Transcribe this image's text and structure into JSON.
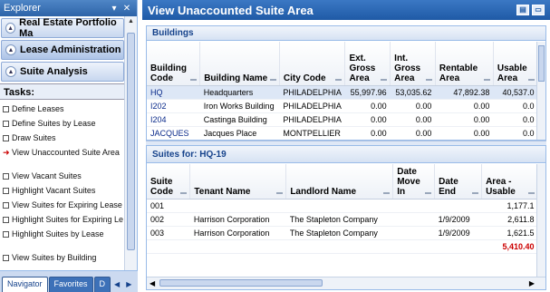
{
  "explorer": {
    "title": "Explorer",
    "pin_icon": "pin-icon",
    "close_icon": "close-icon",
    "sections": [
      {
        "label": "Real Estate Portfolio Ma",
        "icon": "chevron-down-icon"
      },
      {
        "label": "Lease Administration",
        "icon": "chevron-down-icon"
      },
      {
        "label": "Suite Analysis",
        "icon": "chevron-up-icon"
      }
    ],
    "tasks_label": "Tasks:",
    "tasks": [
      {
        "label": "Define Leases",
        "icon": "task-box-icon"
      },
      {
        "label": "Define Suites by Lease",
        "icon": "task-box-icon"
      },
      {
        "label": "Draw Suites",
        "icon": "task-box-icon"
      },
      {
        "label": "View Unaccounted Suite Area",
        "icon": "arrow-right-icon"
      },
      {
        "label": "View Vacant Suites",
        "icon": "task-box-icon"
      },
      {
        "label": "Highlight Vacant Suites",
        "icon": "task-box-icon"
      },
      {
        "label": "View Suites for Expiring Lease",
        "icon": "task-box-icon"
      },
      {
        "label": "Highlight Suites for Expiring Le",
        "icon": "task-box-icon"
      },
      {
        "label": "Highlight Suites by Lease",
        "icon": "task-box-icon"
      },
      {
        "label": "View Suites by Building",
        "icon": "task-box-icon"
      }
    ],
    "tabs": [
      "Navigator",
      "Favorites",
      "D"
    ],
    "tab_nav": [
      "◀",
      "▶"
    ]
  },
  "main": {
    "title": "View Unaccounted Suite Area",
    "buildings": {
      "title": "Buildings",
      "columns": [
        "Building Code",
        "Building Name",
        "City Code",
        "Ext. Gross Area",
        "Int. Gross Area",
        "Rentable Area",
        "Usable Area"
      ],
      "rows": [
        [
          "HQ",
          "Headquarters",
          "PHILADELPHIA",
          "55,997.96",
          "53,035.62",
          "47,892.38",
          "40,537.0"
        ],
        [
          "I202",
          "Iron Works Building",
          "PHILADELPHIA",
          "0.00",
          "0.00",
          "0.00",
          "0.0"
        ],
        [
          "I204",
          "Castinga Building",
          "PHILADELPHIA",
          "0.00",
          "0.00",
          "0.00",
          "0.0"
        ],
        [
          "JACQUES",
          "Jacques Place",
          "MONTPELLIER",
          "0.00",
          "0.00",
          "0.00",
          "0.0"
        ]
      ]
    },
    "suites": {
      "title": "Suites for: HQ-19",
      "columns": [
        "Suite Code",
        "Tenant Name",
        "Landlord Name",
        "Date Move In",
        "Date End",
        "Area - Usable"
      ],
      "rows": [
        [
          "001",
          "",
          "",
          "",
          "",
          "1,177.1"
        ],
        [
          "002",
          "Harrison Corporation",
          "The Stapleton Company",
          "",
          "1/9/2009",
          "2,611.8"
        ],
        [
          "003",
          "Harrison Corporation",
          "The Stapleton Company",
          "",
          "1/9/2009",
          "1,621.5"
        ]
      ],
      "total": "5,410.40"
    }
  },
  "colors": {
    "header": "#2d63a8",
    "accent": "#cc0000",
    "panel_border": "#99bbe8"
  }
}
